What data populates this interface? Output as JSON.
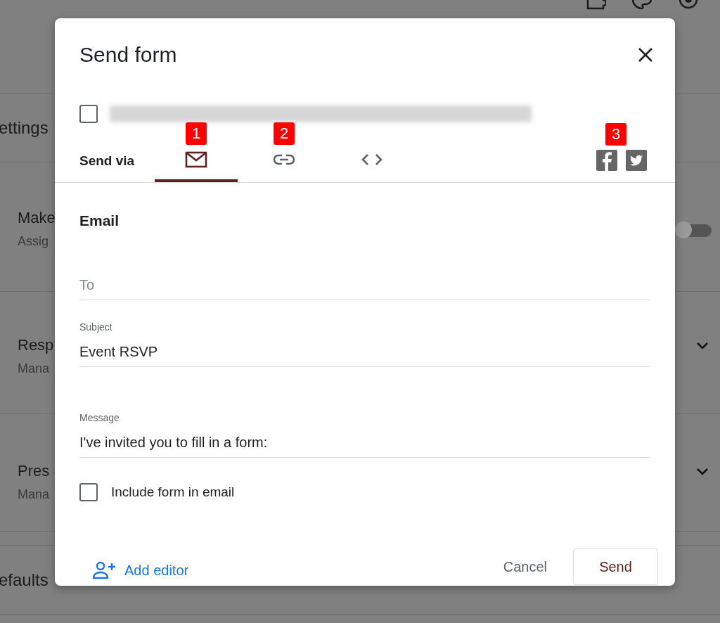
{
  "background": {
    "heading": "ettings",
    "rows": [
      {
        "title": "Make",
        "subtitle": "Assig",
        "kind": "toggle",
        "on": false
      },
      {
        "title": "Resp",
        "subtitle": "Mana",
        "kind": "chevron"
      },
      {
        "title": "Pres",
        "subtitle": "Mana",
        "kind": "chevron"
      }
    ],
    "footer_heading": "efaults"
  },
  "dialog": {
    "title": "Send form",
    "collect_emails": {
      "checked": false
    },
    "send_via": {
      "label": "Send via",
      "tabs": [
        {
          "kind": "email",
          "selected": true,
          "badge": "1"
        },
        {
          "kind": "link",
          "selected": false,
          "badge": "2"
        },
        {
          "kind": "embed",
          "selected": false
        }
      ],
      "social_badge": "3",
      "social": [
        {
          "kind": "facebook"
        },
        {
          "kind": "twitter"
        }
      ]
    },
    "section_title": "Email",
    "fields": [
      {
        "placeholder": "To"
      },
      {
        "label": "Subject",
        "value": "Event RSVP"
      },
      {
        "label": "Message",
        "value": "I've invited you to fill in a form:"
      }
    ],
    "include_form": {
      "label": "Include form in email",
      "checked": false
    },
    "add_editor": "Add editor",
    "buttons": [
      {
        "label": "Cancel",
        "kind": "text"
      },
      {
        "label": "Send",
        "kind": "outlined"
      }
    ]
  }
}
